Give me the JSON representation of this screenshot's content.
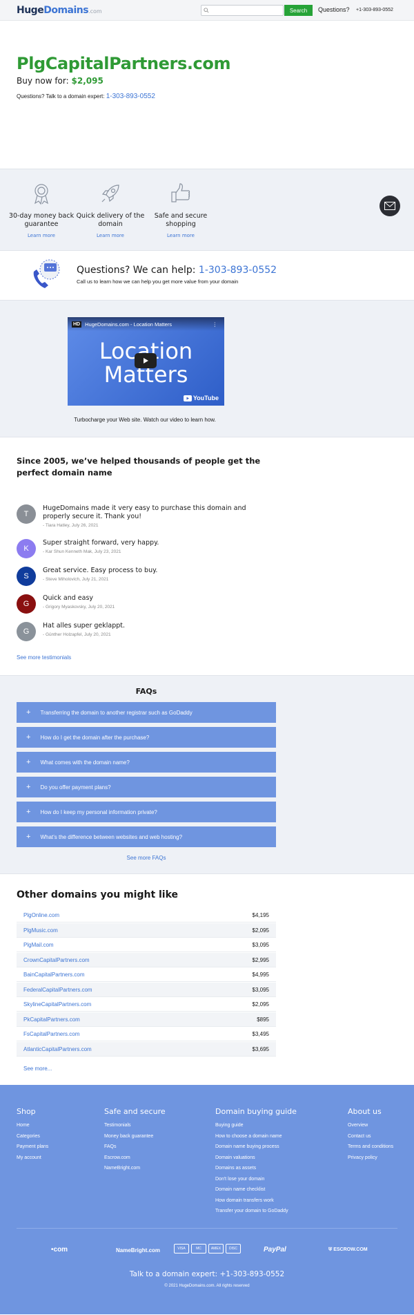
{
  "header": {
    "logo_a": "Huge",
    "logo_b": "Domains",
    "logo_c": ".com",
    "search_placeholder": "",
    "search_button": "Search",
    "questions": "Questions?",
    "phone": "+1-303-893-0552"
  },
  "hero": {
    "domain": "PlgCapitalPartners.com",
    "buy_label": "Buy now for:",
    "price": "$2,095",
    "expert_label": "Questions? Talk to a domain expert:",
    "expert_phone": "1-303-893-0552"
  },
  "features": [
    {
      "title": "30-day money back guarantee",
      "link": "Learn more",
      "icon": "award-ribbon-icon"
    },
    {
      "title": "Quick delivery of the domain",
      "link": "Learn more",
      "icon": "rocket-icon"
    },
    {
      "title": "Safe and secure shopping",
      "link": "Learn more",
      "icon": "thumbs-up-icon"
    }
  ],
  "help": {
    "title": "Questions? We can help:",
    "phone": "1-303-893-0552",
    "subtitle": "Call us to learn how we can help you get more value from your domain"
  },
  "video": {
    "hd": "HD",
    "title": "HugeDomains.com - Location Matters",
    "line1": "Location",
    "line2": "Matters",
    "brand": "YouTube",
    "caption": "Turbocharge your Web site. Watch our video to learn how."
  },
  "testimonials": {
    "heading": "Since 2005, we’ve helped thousands of people get the perfect domain name",
    "items": [
      {
        "initial": "T",
        "color": "#8a8f96",
        "quote": "HugeDomains made it very easy to purchase this domain and properly secure it. Thank you!",
        "author": "- Tiara Hatley, July 26, 2021"
      },
      {
        "initial": "K",
        "color": "#8c7cf0",
        "quote": "Super straight forward, very happy.",
        "author": "- Kar Shun Kenneth Mak, July 23, 2021"
      },
      {
        "initial": "S",
        "color": "#103c9c",
        "quote": "Great service. Easy process to buy.",
        "author": "- Steve Miholovich, July 21, 2021"
      },
      {
        "initial": "G",
        "color": "#8a1010",
        "quote": "Quick and easy",
        "author": "- Grigory Myaskovsky, July 20, 2021"
      },
      {
        "initial": "G",
        "color": "#8a929a",
        "quote": "Hat alles super geklappt.",
        "author": "- Günther Holzapfel, July 20, 2021"
      }
    ],
    "more": "See more testimonials"
  },
  "faqs": {
    "heading": "FAQs",
    "items": [
      "Transferring the domain to another registrar such as GoDaddy",
      "How do I get the domain after the purchase?",
      "What comes with the domain name?",
      "Do you offer payment plans?",
      "How do I keep my personal information private?",
      "What’s the difference between websites and web hosting?"
    ],
    "more": "See more FAQs"
  },
  "other": {
    "heading": "Other domains you might like",
    "items": [
      {
        "name": "PlgOnline.com",
        "price": "$4,195"
      },
      {
        "name": "PlgMusic.com",
        "price": "$2,095"
      },
      {
        "name": "PlgMail.com",
        "price": "$3,095"
      },
      {
        "name": "CrownCapitalPartners.com",
        "price": "$2,995"
      },
      {
        "name": "BainCapitalPartners.com",
        "price": "$4,995"
      },
      {
        "name": "FederalCapitalPartners.com",
        "price": "$3,095"
      },
      {
        "name": "SkylineCapitalPartners.com",
        "price": "$2,095"
      },
      {
        "name": "PkCapitalPartners.com",
        "price": "$895"
      },
      {
        "name": "FsCapitalPartners.com",
        "price": "$3,495"
      },
      {
        "name": "AtlanticCapitalPartners.com",
        "price": "$3,695"
      }
    ],
    "more": "See more..."
  },
  "footer": {
    "cols": [
      {
        "title": "Shop",
        "links": [
          "Home",
          "Categories",
          "Payment plans",
          "My account"
        ]
      },
      {
        "title": "Safe and secure",
        "links": [
          "Testimonials",
          "Money back guarantee",
          "FAQs",
          "Escrow.com",
          "NameBright.com"
        ]
      },
      {
        "title": "Domain buying guide",
        "links": [
          "Buying guide",
          "How to choose a domain name",
          "Domain name buying process",
          "Domain valuations",
          "Domains as assets",
          "Don't lose your domain",
          "Domain name checklist",
          "How domain transfers work",
          "Transfer your domain to GoDaddy"
        ]
      },
      {
        "title": "About us",
        "links": [
          "Overview",
          "Contact us",
          "Terms and conditions",
          "Privacy policy"
        ]
      }
    ],
    "logo_com": "•com",
    "logo_namebright": "NameBright.com",
    "cards": [
      "VISA",
      "MC",
      "AMEX",
      "DISC"
    ],
    "paypal": "PayPal",
    "escrow": "ESCROW.COM",
    "talk": "Talk to a domain expert: +1-303-893-0552",
    "copyright": "© 2021 HugeDomains.com. All rights reserved"
  }
}
